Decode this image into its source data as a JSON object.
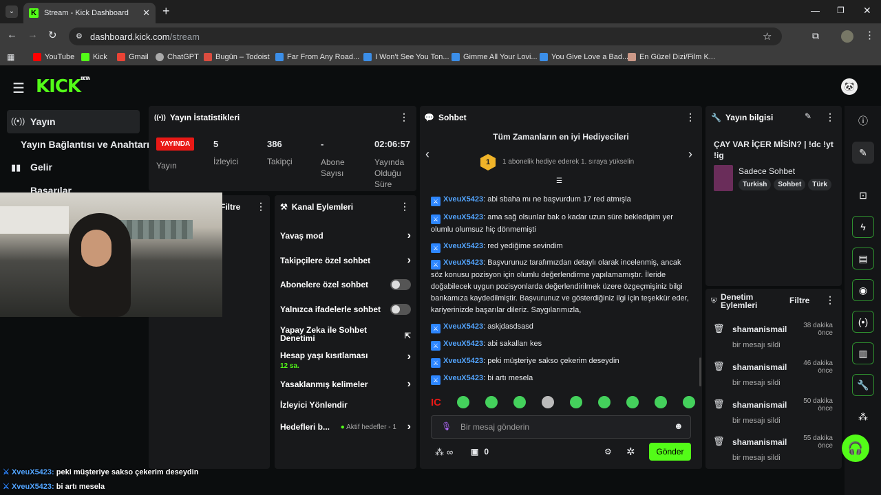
{
  "browser": {
    "tab_title": "Stream - Kick Dashboard",
    "url_host": "dashboard.kick.com",
    "url_path": "/stream",
    "bookmarks": [
      "YouTube",
      "Kick",
      "Gmail",
      "ChatGPT",
      "Bugün – Todoist",
      "Far From Any Road...",
      "I Won't See You Ton...",
      "Gimme All Your Lovi...",
      "You Give Love a Bad...",
      "En Güzel Dizi/Film K..."
    ]
  },
  "logo": {
    "text": "KICK",
    "badge": "BETA"
  },
  "sidebar": {
    "items": [
      {
        "label": "Yayın"
      },
      {
        "label": "Yayın Bağlantısı ve Anahtarı"
      },
      {
        "label": "Gelir"
      },
      {
        "label": "Başarılar"
      }
    ]
  },
  "stats": {
    "title": "Yayın İstatistikleri",
    "live_badge": "YAYINDA",
    "stream_label": "Yayın",
    "viewers": "5",
    "viewers_label": "İzleyici",
    "followers": "386",
    "followers_label": "Takipçi",
    "subs": "-",
    "subs_label": "Abone Sayısı",
    "uptime": "02:06:57",
    "uptime_label": "Yayında Olduğu Süre"
  },
  "filter_panel": {
    "title": "Filtre"
  },
  "channel_actions": {
    "title": "Kanal Eylemleri",
    "slow": "Yavaş mod",
    "followers": "Takipçilere özel sohbet",
    "subs": "Abonelere özel sohbet",
    "emote": "Yalnızca ifadelerle sohbet",
    "ai": "Yapay Zeka ile Sohbet Denetimi",
    "age": "Hesap yaşı kısıtlaması",
    "age_value": "12 sa.",
    "banned": "Yasaklanmış kelimeler",
    "raid": "İzleyici Yönlendir",
    "goals": "Hedefleri b...",
    "goals_status": "Aktif hedefler - 1"
  },
  "chat": {
    "title": "Sohbet",
    "gifters_title": "Tüm Zamanların en iyi Hediyecileri",
    "gift_rank": "1",
    "gifters_text": "1 abonelik hediye ederek 1. sıraya yükselin",
    "placeholder": "Bir mesaj gönderin",
    "points": "∞",
    "chests": "0",
    "send": "Gönder",
    "messages": [
      {
        "user": "XveuX5423",
        "text": ": abi sbaha mı ne başvurdum 17 red atmışla"
      },
      {
        "user": "XveuX5423",
        "text": ": ama sağ olsunlar bak o kadar uzun süre bekledipim yer olumlu olumsuz hiç dönmemişti"
      },
      {
        "user": "XveuX5423",
        "text": ": red yediğime sevindim"
      },
      {
        "user": "XveuX5423",
        "text": ": Başvurunuz tarafımızdan detaylı olarak incelenmiş, ancak söz konusu pozisyon için olumlu değerlendirme yapılamamıştır. İleride doğabilecek uygun pozisyonlarda değerlendirilmek üzere özgeçmişiniz bilgi bankamıza kaydedilmiştir. Başvurunuz ve gösterdiğiniz ilgi için teşekkür eder, kariyerinizde başarılar dileriz. Saygılarımızla,"
      },
      {
        "user": "XveuX5423",
        "text": ": askjdasdsasd"
      },
      {
        "user": "XveuX5423",
        "text": ": abi sakalları kes"
      },
      {
        "user": "XveuX5423",
        "text": ": peki müşteriye sakso çekerim deseydin"
      },
      {
        "user": "XveuX5423",
        "text": ": bi artı mesela"
      }
    ]
  },
  "stream_info": {
    "title": "Yayın bilgisi",
    "stream_title": "ÇAY VAR İÇER MİSİN? | !dc !yt !ig",
    "category": "Sadece Sohbet",
    "tags": [
      "Turkish",
      "Sohbet",
      "Türk"
    ]
  },
  "moderation": {
    "title": "Denetim Eylemleri",
    "filter": "Filtre",
    "rows": [
      {
        "user": "shamanismail",
        "action": "bir mesajı sildi",
        "time": "38 dakika önce"
      },
      {
        "user": "shamanismail",
        "action": "bir mesajı sildi",
        "time": "46 dakika önce"
      },
      {
        "user": "shamanismail",
        "action": "bir mesajı sildi",
        "time": "50 dakika önce"
      },
      {
        "user": "shamanismail",
        "action": "bir mesajı sildi",
        "time": "55 dakika önce"
      }
    ]
  },
  "overlay": {
    "lines": [
      {
        "user": "XveuX5423:",
        "text": " peki müşteriye sakso çekerim deseydin"
      },
      {
        "user": "XveuX5423:",
        "text": " bi artı mesela"
      }
    ]
  },
  "colors": {
    "accent": "#53fc18",
    "live": "#e91916",
    "username": "#53a5ff"
  }
}
